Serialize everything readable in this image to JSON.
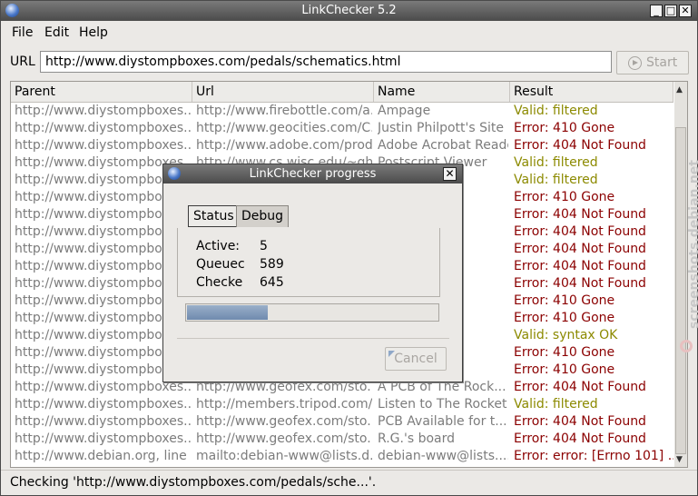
{
  "window": {
    "title": "LinkChecker 5.2"
  },
  "menu": [
    "File",
    "Edit",
    "Help"
  ],
  "url_label": "URL",
  "url_value": "http://www.diystompboxes.com/pedals/schematics.html",
  "start_label": "Start",
  "columns": [
    "Parent",
    "Url",
    "Name",
    "Result"
  ],
  "rows": [
    {
      "parent": "http://www.diystompboxes....",
      "url": "http://www.firebottle.com/a...",
      "name": "Ampage",
      "result": "Valid: filtered",
      "status": "ok"
    },
    {
      "parent": "http://www.diystompboxes....",
      "url": "http://www.geocities.com/C...",
      "name": "Justin  Philpott's Site",
      "result": "Error: 410 Gone",
      "status": "err"
    },
    {
      "parent": "http://www.diystompboxes....",
      "url": "http://www.adobe.com/prod...",
      "name": "Adobe  Acrobat Reader",
      "result": "Error: 404 Not Found",
      "status": "err"
    },
    {
      "parent": "http://www.diystompboxes....",
      "url": "http://www.cs.wisc.edu/~gh...",
      "name": "Postscript  Viewer",
      "result": "Valid: filtered",
      "status": "ok"
    },
    {
      "parent": "http://www.diystompboxes....",
      "url": "",
      "name": "er",
      "result": "Valid: filtered",
      "status": "ok"
    },
    {
      "parent": "http://www.diystompboxes....",
      "url": "",
      "name": "",
      "result": "Error: 410 Gone",
      "status": "err"
    },
    {
      "parent": "http://www.diystompboxes....",
      "url": "",
      "name": "rts lay...",
      "result": "Error: 404 Not Found",
      "status": "err"
    },
    {
      "parent": "http://www.diystompboxes....",
      "url": "",
      "name": "uzz face",
      "result": "Error: 404 Not Found",
      "status": "err"
    },
    {
      "parent": "http://www.diystompboxes....",
      "url": "",
      "name": "",
      "result": "Error: 404 Not Found",
      "status": "err"
    },
    {
      "parent": "http://www.diystompboxes....",
      "url": "",
      "name": "mps a...",
      "result": "Error: 404 Not Found",
      "status": "err"
    },
    {
      "parent": "http://www.diystompboxes....",
      "url": "",
      "name": "zz Fac...",
      "result": "Error: 404 Not Found",
      "status": "err"
    },
    {
      "parent": "http://www.diystompboxes....",
      "url": "",
      "name": "",
      "result": "Error: 410 Gone",
      "status": "err"
    },
    {
      "parent": "http://www.diystompboxes....",
      "url": "",
      "name": "e)",
      "result": "Error: 410 Gone",
      "status": "err"
    },
    {
      "parent": "http://www.diystompboxes....",
      "url": "",
      "name": "es av...",
      "result": "Valid: syntax OK",
      "status": "ok"
    },
    {
      "parent": "http://www.diystompboxes....",
      "url": "",
      "name": "",
      "result": "Error: 410 Gone",
      "status": "err"
    },
    {
      "parent": "http://www.diystompboxes....",
      "url": "",
      "name": "",
      "result": "Error: 410 Gone",
      "status": "err"
    },
    {
      "parent": "http://www.diystompboxes....",
      "url": "http://www.geofex.com/sto...",
      "name": "A PCB    of The Rock...",
      "result": "Error: 404 Not Found",
      "status": "err"
    },
    {
      "parent": "http://www.diystompboxes....",
      "url": "http://members.tripod.com/...",
      "name": "Listen     to The Rocket",
      "result": "Valid: filtered",
      "status": "ok"
    },
    {
      "parent": "http://www.diystompboxes....",
      "url": "http://www.geofex.com/sto...",
      "name": "PCB Available     for t...",
      "result": "Error: 404 Not Found",
      "status": "err"
    },
    {
      "parent": "http://www.diystompboxes....",
      "url": "http://www.geofex.com/sto...",
      "name": "R.G.'s     board",
      "result": "Error: 404 Not Found",
      "status": "err"
    },
    {
      "parent": "http://www.debian.org, line ...",
      "url": "mailto:debian-www@lists.d...",
      "name": "debian-www@lists....",
      "result": "Error: error: [Errno 101] ...",
      "status": "err"
    }
  ],
  "watermark": "screenshots.debian.net",
  "statusbar": "Checking 'http://www.diystompboxes.com/pedals/sche...'.",
  "dialog": {
    "title": "LinkChecker progress",
    "tabs": [
      "Status",
      "Debug"
    ],
    "active_label": "Active:",
    "active_value": "5",
    "queued_label": "Queuec",
    "queued_value": "589",
    "checked_label": "Checke",
    "checked_value": "645",
    "progress_fraction": 0.32,
    "cancel_label": "Cancel"
  },
  "colors": {
    "valid": "#8c8a00",
    "error": "#8b0000",
    "title_bar": "#5a5a5a"
  }
}
